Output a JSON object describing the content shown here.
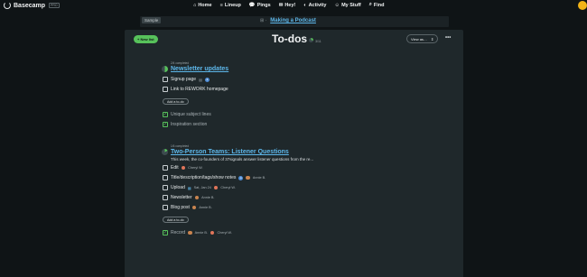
{
  "topbar": {
    "brand": "Basecamp",
    "brand_badge": "PRO",
    "nav": [
      {
        "icon": "home-icon",
        "glyph": "⌂",
        "label": "Home"
      },
      {
        "icon": "lineup-icon",
        "glyph": "≡",
        "label": "Lineup"
      },
      {
        "icon": "pings-icon",
        "glyph": "💬",
        "label": "Pings"
      },
      {
        "icon": "hey-icon",
        "glyph": "✉",
        "label": "Hey!"
      },
      {
        "icon": "activity-icon",
        "glyph": "◐",
        "label": "Activity"
      },
      {
        "icon": "mystuff-icon",
        "glyph": "☺",
        "label": "My Stuff"
      },
      {
        "icon": "find-icon",
        "glyph": "⌕",
        "label": "Find"
      }
    ]
  },
  "strip": {
    "sample": "Sample",
    "project_link": "Making a Podcast",
    "crumb_glyph": "⊞ ·"
  },
  "card": {
    "new_list": "+ New list",
    "title": "To-dos",
    "title_ratio": "3/11",
    "view_as": "View as…",
    "view_as_glyph": "⇕",
    "more": "•••",
    "add_todo": "Add a to-do"
  },
  "lists": [
    {
      "meta": "2/4 completed",
      "name": "Newsletter updates",
      "progress": 0.5,
      "todos": [
        {
          "label": "Signup page",
          "done": false,
          "icons": [
            "doc",
            "badge"
          ]
        },
        {
          "label": "Link to REWORK homepage",
          "done": false
        }
      ],
      "done_todos": [
        {
          "label": "Unique subject lines",
          "done": true
        },
        {
          "label": "Inspiration section",
          "done": true
        }
      ]
    },
    {
      "meta": "1/6 completed",
      "name": "Two-Person Teams: Listener Questions",
      "description": "This week, the co-founders of 37signals answer listener questions from the re...",
      "progress": 0.17,
      "todos": [
        {
          "label": "Edit",
          "done": false,
          "people": [
            "Cheryl W."
          ]
        },
        {
          "label": "Title/description/tags/show notes",
          "done": false,
          "badge": true,
          "people": [
            "Annie B."
          ]
        },
        {
          "label": "Upload",
          "done": false,
          "due": "Sat, Jan 24",
          "people": [
            "Cheryl W."
          ]
        },
        {
          "label": "Newsletter",
          "done": false,
          "people": [
            "Annie B."
          ]
        },
        {
          "label": "Blog post",
          "done": false,
          "people": [
            "Annie B."
          ]
        }
      ],
      "done_todos": [
        {
          "label": "Record",
          "done": true,
          "people": [
            "Annie B.",
            "Cheryl W."
          ]
        }
      ]
    }
  ],
  "colors": {
    "accent_green": "#57c25b",
    "link_blue": "#5db7ea",
    "background": "#0f1416",
    "card": "#1f282b"
  }
}
